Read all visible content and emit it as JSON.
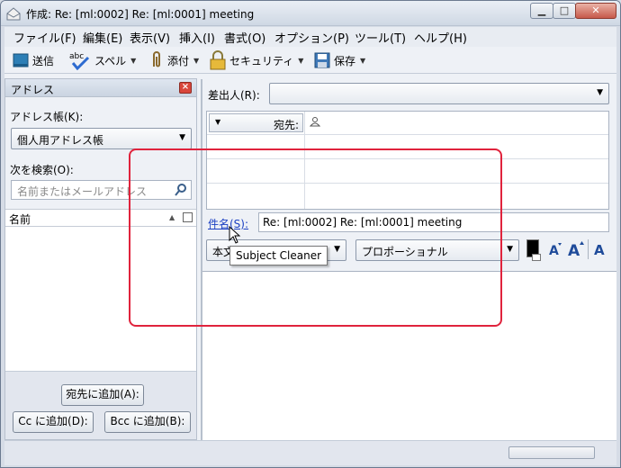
{
  "window": {
    "title": "作成: Re: [ml:0002] Re: [ml:0001] meeting",
    "minimize": "▁",
    "maximize": "□",
    "close": "✕"
  },
  "menubar": [
    "ファイル(F)",
    "編集(E)",
    "表示(V)",
    "挿入(I)",
    "書式(O)",
    "オプション(P)",
    "ツール(T)",
    "ヘルプ(H)"
  ],
  "toolbar": {
    "send": "送信",
    "spell": "スペル",
    "attach": "添付",
    "security": "セキュリティ",
    "save": "保存",
    "abc": "abc"
  },
  "address_pane": {
    "title": "アドレス",
    "book_label": "アドレス帳(K):",
    "book_value": "個人用アドレス帳",
    "search_label": "次を検索(O):",
    "search_placeholder": "名前またはメールアドレス",
    "column_name": "名前",
    "add_to": "宛先に追加(A):",
    "add_cc": "Cc に追加(D):",
    "add_bcc": "Bcc に追加(B):"
  },
  "compose": {
    "from_label": "差出人(R):",
    "from_value": "",
    "recipient_type": "宛先:",
    "subject_label": "件名(S):",
    "subject_value": "Re: [ml:0002] Re: [ml:0001] meeting",
    "body_format": "本文",
    "font": "プロポーショナル",
    "tooltip": "Subject Cleaner"
  },
  "colors": {
    "annotation": "#e0233c",
    "link": "#1a3fc2"
  }
}
